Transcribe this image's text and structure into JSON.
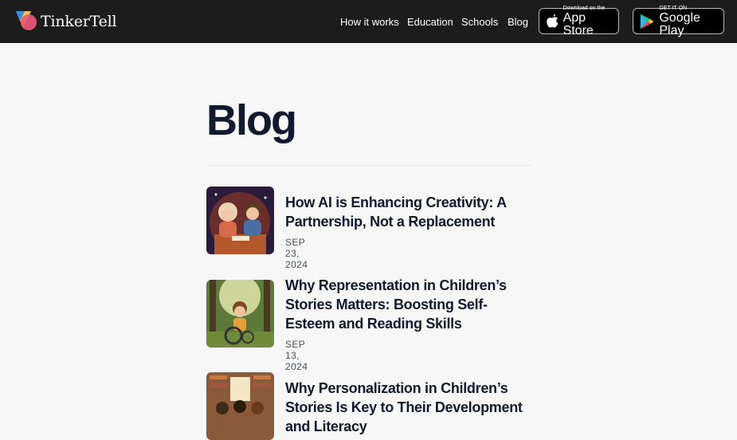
{
  "header": {
    "brand": "TinkerTell",
    "nav": [
      "How it works",
      "Education",
      "Schools",
      "Blog"
    ],
    "app_store": {
      "small": "Download on the",
      "big": "App Store"
    },
    "google_play": {
      "small": "GET IT ON",
      "big": "Google Play"
    }
  },
  "page": {
    "title": "Blog"
  },
  "posts": [
    {
      "title": "How AI is Enhancing Creativity: A Partnership, Not a Replacement",
      "date": "SEP 23, 2024"
    },
    {
      "title": "Why Representation in Children’s Stories Matters: Boosting Self-Esteem and Reading Skills",
      "date": "SEP 13, 2024"
    },
    {
      "title": "Why Personalization in Children’s Stories Is Key to Their Development and Literacy",
      "date": ""
    }
  ],
  "colors": {
    "topbar": "#1c1c1c",
    "background": "#f7f7f7",
    "heading": "#111a2e"
  }
}
